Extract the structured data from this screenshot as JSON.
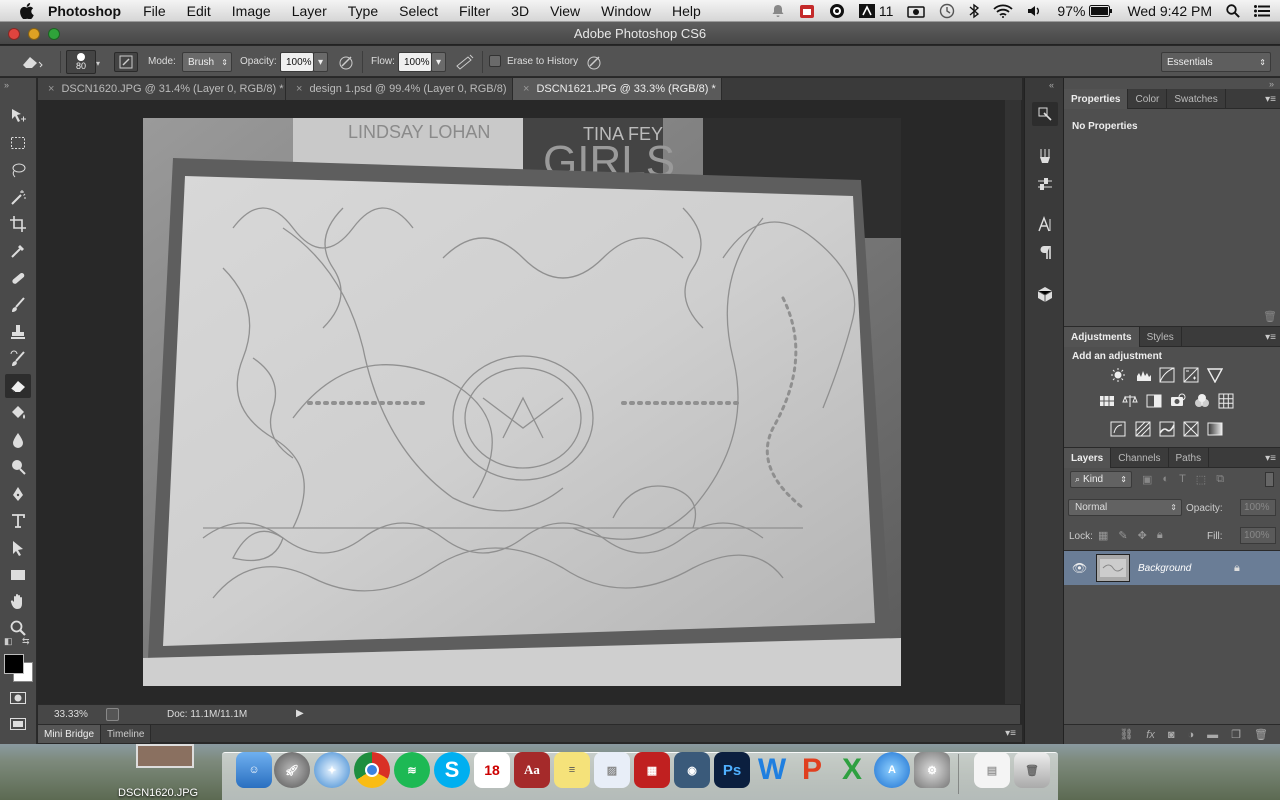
{
  "menubar": {
    "app_name": "Photoshop",
    "menus": [
      "File",
      "Edit",
      "Image",
      "Layer",
      "Type",
      "Select",
      "Filter",
      "3D",
      "View",
      "Window",
      "Help"
    ],
    "status": {
      "number_badge": "11",
      "battery": "97%",
      "datetime": "Wed 9:42 PM"
    }
  },
  "window": {
    "title": "Adobe Photoshop CS6"
  },
  "options_bar": {
    "brush_size": "80",
    "mode_label": "Mode:",
    "mode_value": "Brush",
    "opacity_label": "Opacity:",
    "opacity_value": "100%",
    "flow_label": "Flow:",
    "flow_value": "100%",
    "erase_history_label": "Erase to History",
    "erase_history_checked": false,
    "workspace": "Essentials"
  },
  "document_tabs": [
    {
      "label": "DSCN1620.JPG @ 31.4% (Layer 0, RGB/8) *",
      "active": false
    },
    {
      "label": "design 1.psd @ 99.4% (Layer 0, RGB/8)",
      "active": false
    },
    {
      "label": "DSCN1621.JPG @ 33.3% (RGB/8) *",
      "active": true
    }
  ],
  "photo": {
    "book_text_1": "LINDSAY LOHAN",
    "book_text_2": "TINA FEY",
    "book_text_3": "GIRLS"
  },
  "status_bar": {
    "zoom": "33.33%",
    "doc_info": "Doc: 11.1M/11.1M"
  },
  "bottom_tabs": [
    "Mini Bridge",
    "Timeline"
  ],
  "properties_panel": {
    "tabs": [
      "Properties",
      "Color",
      "Swatches"
    ],
    "active_tab": "Properties",
    "message": "No Properties"
  },
  "adjustments_panel": {
    "tabs": [
      "Adjustments",
      "Styles"
    ],
    "active_tab": "Adjustments",
    "heading": "Add an adjustment"
  },
  "layers_panel": {
    "tabs": [
      "Layers",
      "Channels",
      "Paths"
    ],
    "active_tab": "Layers",
    "filter_label": "Kind",
    "blend_mode": "Normal",
    "opacity_label": "Opacity:",
    "opacity_value": "100%",
    "lock_label": "Lock:",
    "fill_label": "Fill:",
    "fill_value": "100%",
    "layers": [
      {
        "name": "Background",
        "visible": true,
        "locked": true
      }
    ]
  },
  "desktop": {
    "file_label": "DSCN1620.JPG"
  },
  "colors": {
    "accent_selected_layer": "#6a7d96",
    "panel_bg": "#4f4f4f",
    "canvas_bg": "#282828"
  }
}
